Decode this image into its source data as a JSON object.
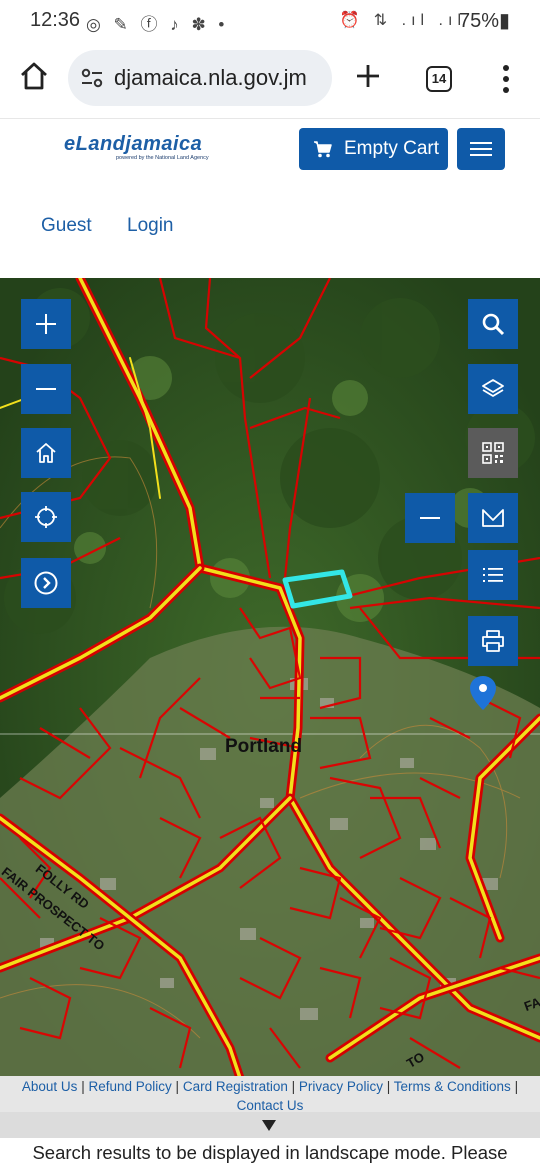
{
  "status_bar": {
    "time": "12:36",
    "left_icons": "◎ ✎ ⓕ ♪ ✽ •",
    "right_icons": "⏰ ⇅ .ıl .ıl",
    "battery": "75%▮"
  },
  "browser": {
    "url": "djamaica.nla.gov.jm",
    "tab_count": "14"
  },
  "site": {
    "brand": "eLandjamaica",
    "tagline": "powered by the National Land Agency",
    "cart_label": "Empty Cart",
    "nav": {
      "guest": "Guest",
      "login": "Login"
    }
  },
  "map": {
    "place_label": "Portland",
    "road_labels": [
      "FAIR PROSPECT TO",
      "FOLLY RD",
      "TO",
      "FA"
    ],
    "controls_left": [
      "plus-icon",
      "minus-icon",
      "home-icon",
      "locate-icon",
      "chevron-right-icon"
    ],
    "controls_right": [
      "search-icon",
      "layers-icon",
      "qr-code-icon",
      "minus-icon",
      "envelope-icon",
      "list-icon",
      "print-icon"
    ],
    "selected_parcel_color": "#33e6e6",
    "boundary_color": "#e00000",
    "road_color": "#f2e01c"
  },
  "footer": {
    "links": [
      "About Us",
      "Refund Policy",
      "Card Registration",
      "Privacy Policy",
      "Terms & Conditions",
      "Contact Us"
    ],
    "separator": "|"
  },
  "notice": "Search results to be displayed in landscape mode. Please"
}
